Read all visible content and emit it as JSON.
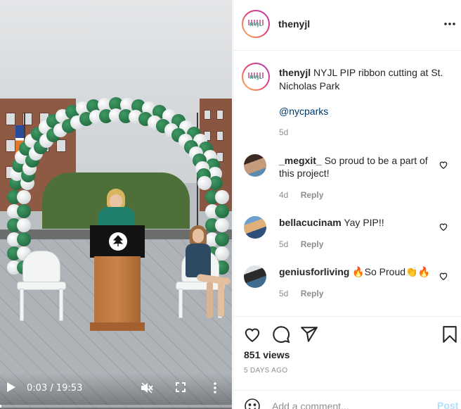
{
  "video": {
    "current_time": "0:03",
    "separator": "/",
    "duration": "19:53",
    "progress_fraction": 0.0025
  },
  "post": {
    "username": "thenyjl",
    "caption_user": "thenyjl",
    "caption_text": "NYJL PIP ribbon cutting at St. Nicholas Park",
    "mention": "@nycparks",
    "caption_age": "5d",
    "avatar_text": "NYJL"
  },
  "comments": [
    {
      "user": "_megxit_",
      "text": "So proud to be a part of this project!",
      "age": "4d",
      "reply": "Reply"
    },
    {
      "user": "bellacucinam",
      "text": "Yay PIP!!",
      "age": "5d",
      "reply": "Reply"
    },
    {
      "user": "geniusforliving",
      "text": "🔥So Proud👏🔥",
      "age": "5d",
      "reply": "Reply"
    }
  ],
  "stats": {
    "views": "851 views",
    "posted": "5 DAYS AGO"
  },
  "composer": {
    "placeholder": "Add a comment...",
    "post_label": "Post"
  },
  "icons": {
    "play": "play-icon",
    "mute": "muted-speaker-icon",
    "fullscreen": "fullscreen-icon",
    "more": "vertical-dots-icon",
    "menu": "horizontal-dots-icon",
    "like": "heart-icon",
    "comment": "speech-bubble-icon",
    "share": "paper-plane-icon",
    "save": "bookmark-icon",
    "emoji": "smiley-icon"
  },
  "colors": {
    "link": "#00376b",
    "muted": "#8e8e8e",
    "post_disabled": "#b2dffc",
    "balloon_green": "#1f6e43"
  }
}
